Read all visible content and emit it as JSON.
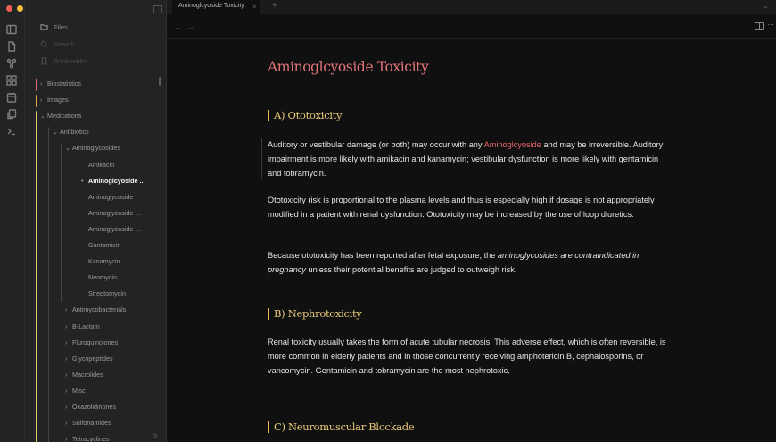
{
  "window": {
    "traffic_colors": [
      "#f25f58",
      "#f6be3b",
      "#3ec84a"
    ]
  },
  "ribbon": {
    "icons": [
      "sidebar-toggle-icon",
      "file-icon",
      "graph-icon",
      "grid-icon",
      "calendar-icon",
      "copy-icon",
      "terminal-icon"
    ]
  },
  "sidebar": {
    "files_label": "Files",
    "search_label": "Search",
    "bookmarks_label": "Bookmarks",
    "tree": [
      {
        "label": "Biostatistics",
        "depth": 0,
        "chevron": "›",
        "active": false
      },
      {
        "label": "Images",
        "depth": 0,
        "chevron": "›",
        "active": false
      },
      {
        "label": "Medications",
        "depth": 0,
        "chevron": "⌄",
        "active": false
      },
      {
        "label": "Antibiotics",
        "depth": 1,
        "chevron": "⌄",
        "active": false
      },
      {
        "label": "Aminoglycosides",
        "depth": 2,
        "chevron": "⌄",
        "active": false
      },
      {
        "label": "Amikacin",
        "depth": 3,
        "chevron": "",
        "active": false
      },
      {
        "label": "Aminoglcyoside ...",
        "depth": 3,
        "chevron": "•",
        "active": true
      },
      {
        "label": "Aminoglycoside",
        "depth": 3,
        "chevron": "",
        "active": false
      },
      {
        "label": "Aminoglycoside ...",
        "depth": 3,
        "chevron": "",
        "active": false
      },
      {
        "label": "Aminoglycoside ...",
        "depth": 3,
        "chevron": "",
        "active": false
      },
      {
        "label": "Gentamicin",
        "depth": 3,
        "chevron": "",
        "active": false
      },
      {
        "label": "Kanamycin",
        "depth": 3,
        "chevron": "",
        "active": false
      },
      {
        "label": "Neomycin",
        "depth": 3,
        "chevron": "",
        "active": false
      },
      {
        "label": "Streptomycin",
        "depth": 3,
        "chevron": "",
        "active": false
      },
      {
        "label": "Antimycobacterials",
        "depth": 2,
        "chevron": "›",
        "active": false
      },
      {
        "label": "B-Lactam",
        "depth": 2,
        "chevron": "›",
        "active": false
      },
      {
        "label": "Fluroquinolones",
        "depth": 2,
        "chevron": "›",
        "active": false
      },
      {
        "label": "Glycopeptides",
        "depth": 2,
        "chevron": "›",
        "active": false
      },
      {
        "label": "Macrolides",
        "depth": 2,
        "chevron": "›",
        "active": false
      },
      {
        "label": "Misc",
        "depth": 2,
        "chevron": "›",
        "active": false
      },
      {
        "label": "Oxazolidinones",
        "depth": 2,
        "chevron": "›",
        "active": false
      },
      {
        "label": "Sulfonamides",
        "depth": 2,
        "chevron": "›",
        "active": false
      },
      {
        "label": "Tetracyclines",
        "depth": 2,
        "chevron": "›",
        "active": false
      }
    ],
    "guide_colors": {
      "biostatistics": "#e06c75",
      "images": "#e0a84c",
      "medications": "#e8c26a"
    }
  },
  "tabs": [
    {
      "label": "Aminoglcyoside Toxicity",
      "close": "×"
    }
  ],
  "tab_new": "+",
  "tab_menu": "⌄",
  "nav": {
    "back": "←",
    "forward": "→",
    "more": "⋯"
  },
  "doc": {
    "title": "Aminoglcyoside Toxicity",
    "section_a": "A) Ototoxicity",
    "para1_pre": "Auditory or vestibular damage (or both) may occur with any ",
    "para1_link": "Aminoglcyoside",
    "para1_post": " and may be irreversible. Auditory impairment is more likely with amikacin and kanamycin; vestibular dysfunction is more likely with gentamicin and tobramycin.",
    "para2": "Ototoxicity risk is proportional to the plasma levels and thus is especially high if dosage is not appropriately modified in a patient with renal dysfunction. Ototoxicity may be increased by the use of loop diuretics.",
    "para3_pre": "Because ototoxicity has been reported after fetal exposure, the ",
    "para3_em": "aminoglycosides are contraindicated in pregnancy",
    "para3_post": " unless their potential benefits are judged to outweigh risk.",
    "section_b": "B) Nephrotoxicity",
    "para4": "Renal toxicity usually takes the form of acute tubular necrosis. This adverse effect, which is often reversible, is more common in elderly patients and in those concurrently receiving amphotericin B, cephalosporins, or vancomycin. Gentamicin and tobramycin are the most nephrotoxic.",
    "section_c": "C) Neuromuscular Blockade"
  },
  "colors": {
    "title": "#e2767a",
    "heading": "#e8c97a",
    "link": "#e8666b"
  }
}
